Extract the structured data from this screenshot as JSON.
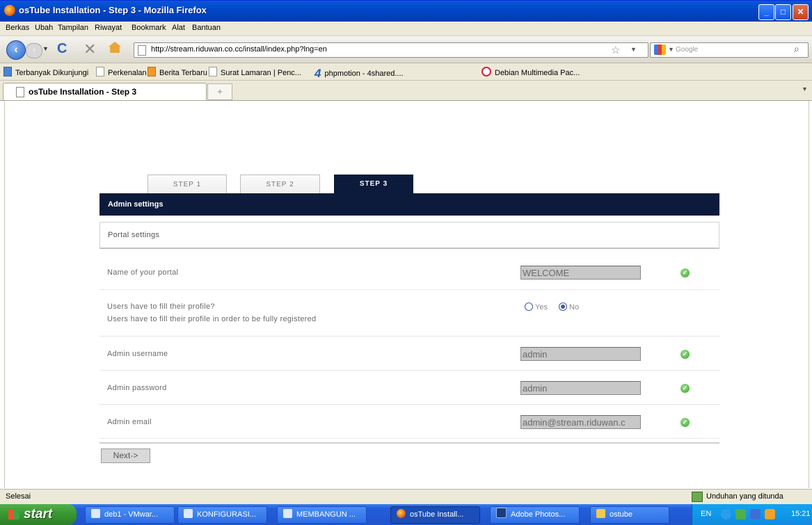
{
  "window": {
    "title": "osTube Installation - Step 3 - Mozilla Firefox"
  },
  "menu": [
    "Berkas",
    "Ubah",
    "Tampilan",
    "Riwayat",
    "Bookmark",
    "Alat",
    "Bantuan"
  ],
  "nav": {
    "url": "http://stream.riduwan.co.cc/install/index.php?lng=en",
    "search_placeholder": "Google"
  },
  "bookmarks": [
    "Terbanyak Dikunjungi",
    "Perkenalan",
    "Berita Terbaru",
    "Surat Lamaran | Penc...",
    "phpmotion - 4shared....",
    "Debian Multimedia Pac..."
  ],
  "tab": {
    "title": "osTube Installation - Step 3",
    "new_tab": "+"
  },
  "steps": [
    "STEP 1",
    "STEP 2",
    "STEP 3"
  ],
  "active_step": "STEP 3",
  "section": {
    "title": "Admin settings",
    "subtitle": "Portal settings"
  },
  "form": {
    "portal_name": {
      "label": "Name of your portal",
      "value": "WELCOME"
    },
    "profile": {
      "label": "Users have to fill their profile?",
      "description": "Users have to fill their profile in order to be fully registered",
      "options": [
        "Yes",
        "No"
      ],
      "selected": "No"
    },
    "admin_username": {
      "label": "Admin username",
      "value": "admin"
    },
    "admin_password": {
      "label": "Admin password",
      "value": "admin"
    },
    "admin_email": {
      "label": "Admin email",
      "value": "admin@stream.riduwan.c"
    },
    "next_label": "Next->"
  },
  "status": {
    "text": "Selesai",
    "downloads": "Unduhan yang ditunda"
  },
  "taskbar": {
    "start": "start",
    "items": [
      "deb1 - VMwar...",
      "KONFIGURASI...",
      "MEMBANGUN ...",
      "osTube Install...",
      "Adobe Photos...",
      "ostube"
    ],
    "lang": "EN",
    "clock": "15:21"
  },
  "colors": {
    "header_navy": "#0c1b3b",
    "ok_green": "#3da52e",
    "xp_blue": "#245edb"
  }
}
